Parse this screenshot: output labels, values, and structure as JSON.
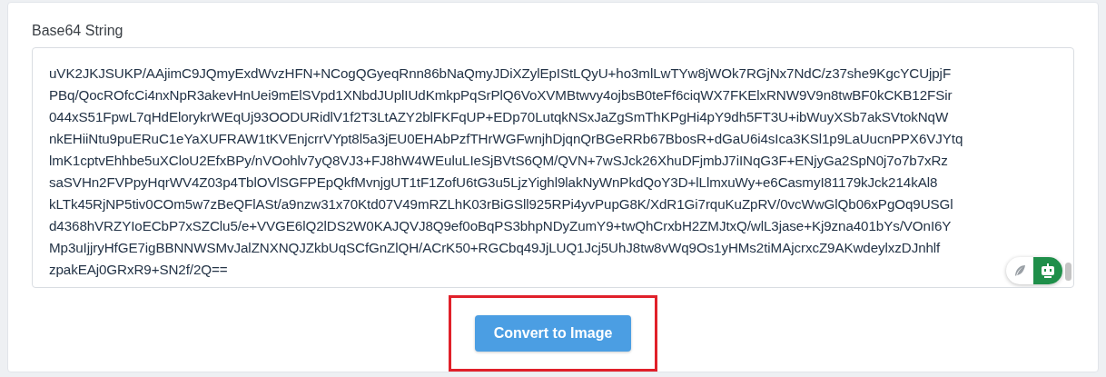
{
  "field": {
    "label": "Base64 String",
    "lines": [
      "uVK2JKJSUKP/AAjimC9JQmyExdWvzHFN+NCogQGyeqRnn86bNaQmyJDiXZylEpIStLQyU+ho3mlLwTYw8jWOk7RGjNx7NdC/z37she9KgcYCUjpjF",
      "PBq/QocROfcCi4nxNpR3akevHnUei9mElSVpd1XNbdJUplIUdKmkpPqSrPlQ6VoXVMBtwvy4ojbsB0teFf6ciqWX7FKElxRNW9V9n8twBF0kCKB12FSir",
      "044xS51FpwL7qHdElorykrWEqUj93OODURidlV1f2T3LtAZY2blFKFqUP+EDp70LutqkNSxJaZgSmThKPgHi4pY9dh5FT3U+ibWuyXSb7akSVtokNqW",
      "nkEHiiNtu9puERuC1eYaXUFRAW1tKVEnjcrrVYpt8l5a3jEU0EHAbPzfTHrWGFwnjhDjqnQrBGeRRb67BbosR+dGaU6i4sIca3KSl1p9LaUucnPPX6VJYtq",
      "lmK1cptvEhhbe5uXCloU2EfxBPy/nVOohlv7yQ8VJ3+FJ8hW4WEuluLIeSjBVtS6QM/QVN+7wSJck26XhuDFjmbJ7iINqG3F+ENjyGa2SpN0j7o7b7xRz",
      "saSVHn2FVPpyHqrWV4Z03p4TblOVlSGFPEpQkfMvnjgUT1tF1ZofU6tG3u5LjzYighl9lakNyWnPkdQoY3D+lLlmxuWy+e6CasmyI81179kJck214kAl8",
      "kLTk45RjNP5tiv0COm5w7zBeQFlASt/a9nzw31x70Ktd07V49mRZLhK03rBiGSll925RPi4yvPupG8K/XdR1Gi7rquKuZpRV/0vcWwGlQb06xPgOq9USGl",
      "d4368hVRZYIoECbP7xSZClu5/e+VVGE6lQ2lDS2W0KAJQVJ8Q9ef0oBqPS3bhpNDyZumY9+twQhCrxbH2ZMJtxQ/wlL3jase+Kj9zna401bYs/VOnI6Y",
      "Mp3uIjjryHfGE7igBBNNWSMvJalZNXNQJZkbUqSCfGnZlQH/ACrK50+RGCbq49JjLUQ1Jcj5UhJ8tw8vWq9Os1yHMs2tiMAjcrxcZ9AKwdeylxzDJnhlf",
      "zpakEAj0GRxR9+SN2f/2Q=="
    ]
  },
  "button": {
    "label": "Convert to Image",
    "highlighted": true
  }
}
